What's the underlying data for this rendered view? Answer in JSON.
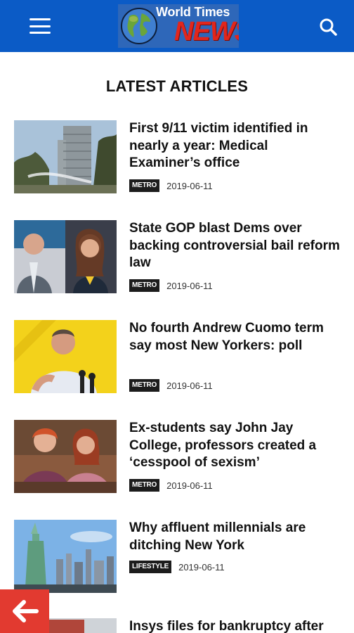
{
  "header": {
    "logo_top": "World Times",
    "logo_bottom": "NEWS",
    "menu_icon": "hamburger-menu-icon",
    "search_icon": "search-icon",
    "bar_color": "#0b5bc6"
  },
  "section_title": "LATEST ARTICLES",
  "articles": [
    {
      "title": "First 9/11 victim identified in nearly a year: Medical Examiner’s office",
      "category": "METRO",
      "date": "2019-06-11"
    },
    {
      "title": "State GOP blast Dems over backing controversial bail reform law",
      "category": "METRO",
      "date": "2019-06-11"
    },
    {
      "title": "No fourth Andrew Cuomo term say most New Yorkers: poll",
      "category": "METRO",
      "date": "2019-06-11"
    },
    {
      "title": "Ex-students say John Jay College, professors created a ‘cesspool of sexism’",
      "category": "METRO",
      "date": "2019-06-11"
    },
    {
      "title": "Why affluent millennials are ditching New York",
      "category": "LIFESTYLE",
      "date": "2019-06-11"
    },
    {
      "title": "Insys files for bankruptcy after"
    }
  ],
  "back_button": {
    "icon": "arrow-left-icon",
    "color": "#e23a30"
  }
}
